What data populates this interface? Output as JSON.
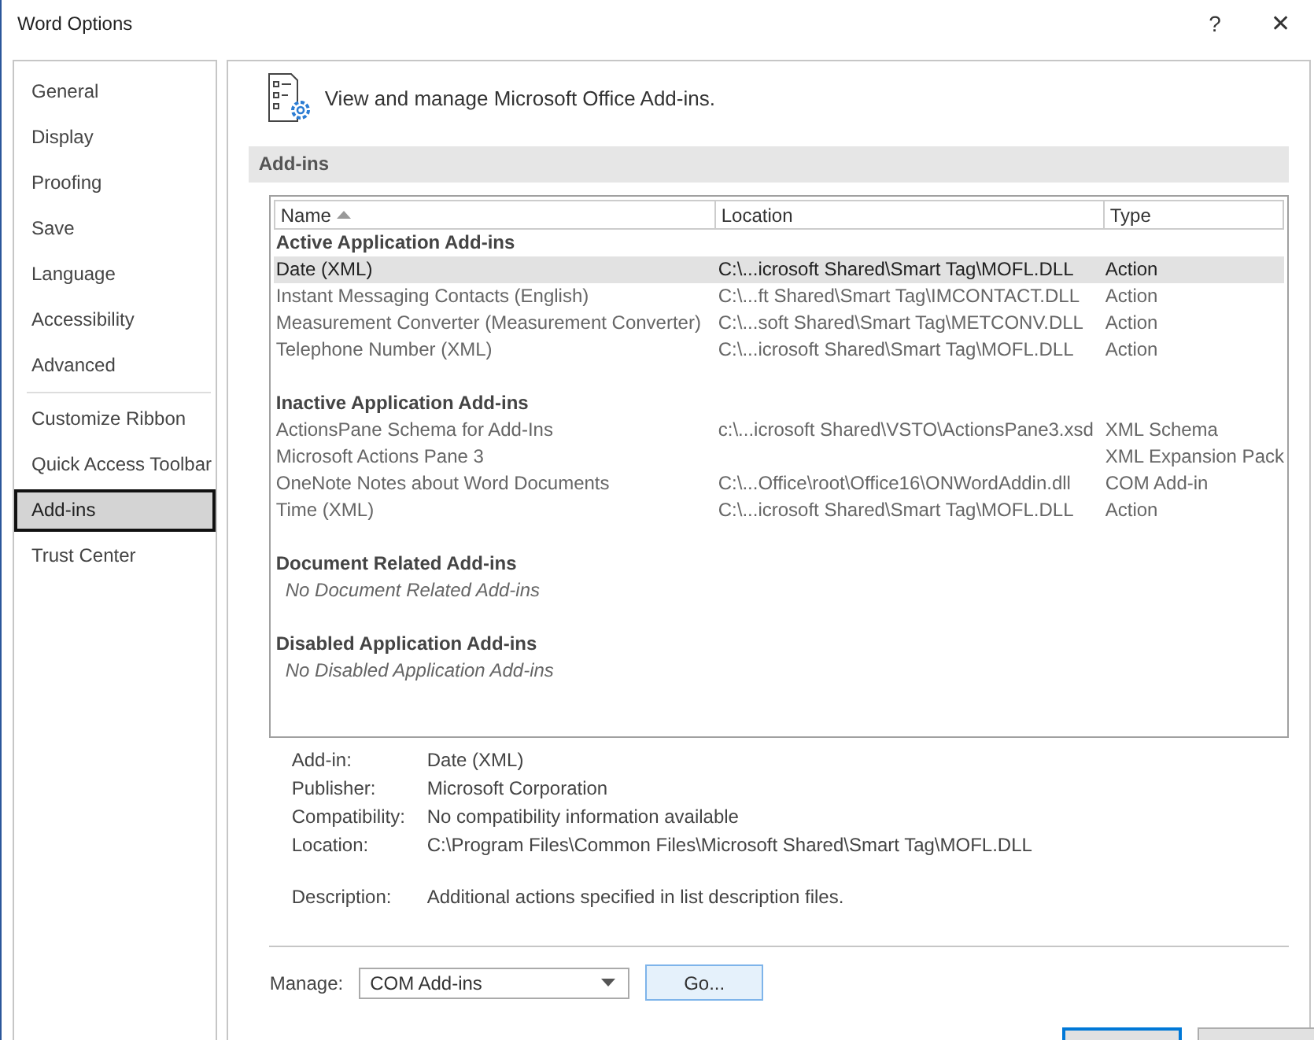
{
  "window": {
    "title": "Word Options",
    "help": "?",
    "close": "✕"
  },
  "sidebar": {
    "groups": [
      [
        {
          "label": "General",
          "selected": false
        },
        {
          "label": "Display",
          "selected": false
        },
        {
          "label": "Proofing",
          "selected": false
        },
        {
          "label": "Save",
          "selected": false
        },
        {
          "label": "Language",
          "selected": false
        },
        {
          "label": "Accessibility",
          "selected": false
        },
        {
          "label": "Advanced",
          "selected": false
        }
      ],
      [
        {
          "label": "Customize Ribbon",
          "selected": false
        },
        {
          "label": "Quick Access Toolbar",
          "selected": false
        },
        {
          "label": "Add-ins",
          "selected": true
        },
        {
          "label": "Trust Center",
          "selected": false
        }
      ]
    ]
  },
  "header": {
    "text": "View and manage Microsoft Office Add-ins."
  },
  "section_title": "Add-ins",
  "table": {
    "columns": [
      "Name",
      "Location",
      "Type"
    ],
    "sections": [
      {
        "title": "Active Application Add-ins",
        "rows": [
          {
            "name": "Date (XML)",
            "location": "C:\\...icrosoft Shared\\Smart Tag\\MOFL.DLL",
            "type": "Action",
            "selected": true
          },
          {
            "name": "Instant Messaging Contacts (English)",
            "location": "C:\\...ft Shared\\Smart Tag\\IMCONTACT.DLL",
            "type": "Action",
            "selected": false
          },
          {
            "name": "Measurement Converter (Measurement Converter)",
            "location": "C:\\...soft Shared\\Smart Tag\\METCONV.DLL",
            "type": "Action",
            "selected": false
          },
          {
            "name": "Telephone Number (XML)",
            "location": "C:\\...icrosoft Shared\\Smart Tag\\MOFL.DLL",
            "type": "Action",
            "selected": false
          }
        ]
      },
      {
        "title": "Inactive Application Add-ins",
        "rows": [
          {
            "name": "ActionsPane Schema for Add-Ins",
            "location": "c:\\...icrosoft Shared\\VSTO\\ActionsPane3.xsd",
            "type": "XML Schema",
            "selected": false
          },
          {
            "name": "Microsoft Actions Pane 3",
            "type": "XML Expansion Pack",
            "selected": false
          },
          {
            "name": "OneNote Notes about Word Documents",
            "location": "C:\\...Office\\root\\Office16\\ONWordAddin.dll",
            "type": "COM Add-in",
            "selected": false
          },
          {
            "name": "Time (XML)",
            "location": "C:\\...icrosoft Shared\\Smart Tag\\MOFL.DLL",
            "type": "Action",
            "selected": false
          }
        ]
      },
      {
        "title": "Document Related Add-ins",
        "empty_text": "No Document Related Add-ins"
      },
      {
        "title": "Disabled Application Add-ins",
        "empty_text": "No Disabled Application Add-ins"
      }
    ]
  },
  "details": [
    {
      "label": "Add-in:",
      "value": "Date (XML)"
    },
    {
      "label": "Publisher:",
      "value": "Microsoft Corporation"
    },
    {
      "label": "Compatibility:",
      "value": "No compatibility information available"
    },
    {
      "label": "Location:",
      "value": "C:\\Program Files\\Common Files\\Microsoft Shared\\Smart Tag\\MOFL.DLL"
    },
    {
      "label": "Description:",
      "value": "Additional actions specified in list description files.",
      "gap": true
    }
  ],
  "manage": {
    "label": "Manage:",
    "value": "COM Add-ins",
    "button": "Go..."
  }
}
